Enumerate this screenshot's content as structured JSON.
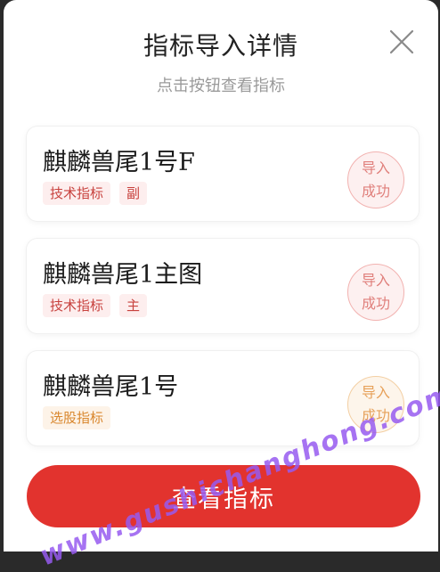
{
  "dialog": {
    "title": "指标导入详情",
    "subtitle": "点击按钮查看指标",
    "close_icon": "close-icon"
  },
  "cards": [
    {
      "name": "麒麟兽尾1号F",
      "tags": [
        "技术指标",
        "副"
      ],
      "tag_colors": [
        "red",
        "red"
      ],
      "status_line1": "导入",
      "status_line2": "成功",
      "status_color": "red"
    },
    {
      "name": "麒麟兽尾1主图",
      "tags": [
        "技术指标",
        "主"
      ],
      "tag_colors": [
        "red",
        "red"
      ],
      "status_line1": "导入",
      "status_line2": "成功",
      "status_color": "red"
    },
    {
      "name": "麒麟兽尾1号",
      "tags": [
        "选股指标"
      ],
      "tag_colors": [
        "orange"
      ],
      "status_line1": "导入",
      "status_line2": "成功",
      "status_color": "orange"
    }
  ],
  "cta": {
    "label": "查看指标"
  },
  "watermark": {
    "text": "www.gushichanghong.com"
  },
  "colors": {
    "accent": "#e2332e",
    "tag_red": "#c8423e",
    "tag_orange": "#d9872e"
  }
}
